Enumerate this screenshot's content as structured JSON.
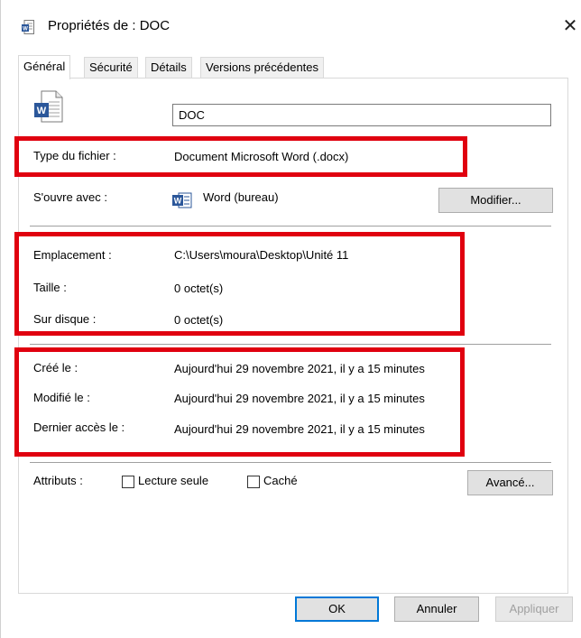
{
  "window": {
    "title": "Propriétés de : DOC",
    "close_glyph": "✕"
  },
  "tabs": [
    {
      "label": "Général",
      "active": true
    },
    {
      "label": "Sécurité",
      "active": false
    },
    {
      "label": "Détails",
      "active": false
    },
    {
      "label": "Versions précédentes",
      "active": false
    }
  ],
  "general": {
    "file_name": "DOC",
    "file_type_label": "Type du fichier :",
    "file_type_value": "Document Microsoft Word (.docx)",
    "opens_with_label": "S'ouvre avec :",
    "opens_with_value": "Word (bureau)",
    "change_button": "Modifier...",
    "location_label": "Emplacement :",
    "location_value": "C:\\Users\\moura\\Desktop\\Unité 11",
    "size_label": "Taille :",
    "size_value": "0 octet(s)",
    "on_disk_label": "Sur disque :",
    "on_disk_value": "0 octet(s)",
    "created_label": "Créé le :",
    "created_value": "Aujourd'hui 29 novembre 2021, il y a 15 minutes",
    "modified_label": "Modifié le :",
    "modified_value": "Aujourd'hui 29 novembre 2021, il y a 15 minutes",
    "accessed_label": "Dernier accès le :",
    "accessed_value": "Aujourd'hui 29 novembre 2021, il y a 15 minutes",
    "attributes_label": "Attributs :",
    "readonly_label": "Lecture seule",
    "hidden_label": "Caché",
    "readonly_checked": false,
    "hidden_checked": false,
    "advanced_button": "Avancé..."
  },
  "footer": {
    "ok": "OK",
    "cancel": "Annuler",
    "apply": "Appliquer"
  },
  "icons": {
    "title": "word-document-icon",
    "file": "word-document-icon",
    "app": "word-app-icon"
  },
  "colors": {
    "highlight": "#e0000f",
    "word_blue": "#2b579a",
    "focus": "#0078d7"
  }
}
